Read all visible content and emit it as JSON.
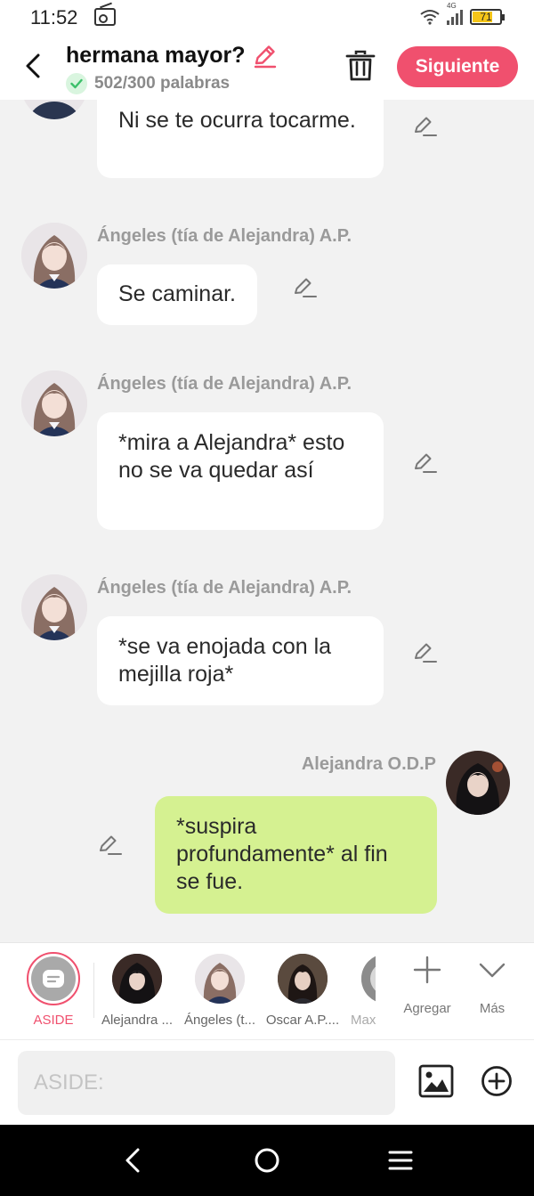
{
  "status": {
    "time": "11:52",
    "network": "4G",
    "battery": "71"
  },
  "header": {
    "title": "hermana mayor?",
    "word_count": "502/300 palabras",
    "next_label": "Siguiente"
  },
  "messages": [
    {
      "sender": "",
      "text": "Ni se te ocurra tocarme."
    },
    {
      "sender": "Ángeles (tía de Alejandra) A.P.",
      "text": "Se caminar."
    },
    {
      "sender": "Ángeles (tía de Alejandra) A.P.",
      "text": "*mira a Alejandra* esto no se va quedar así"
    },
    {
      "sender": "Ángeles (tía de Alejandra) A.P.",
      "text": "*se va enojada con la mejilla roja*"
    },
    {
      "sender": "Alejandra O.D.P",
      "text": "*suspira profundamente* al fin se fue."
    }
  ],
  "characters": [
    {
      "name": "ASIDE"
    },
    {
      "name": "Alejandra ..."
    },
    {
      "name": "Ángeles (t..."
    },
    {
      "name": "Oscar A.P...."
    },
    {
      "name": "Max"
    }
  ],
  "actions": {
    "add": "Agregar",
    "more": "Más"
  },
  "input": {
    "placeholder": "ASIDE:"
  },
  "colors": {
    "accent": "#f0506e",
    "my_bubble": "#d5f191",
    "other_bubble": "#ffffff"
  }
}
